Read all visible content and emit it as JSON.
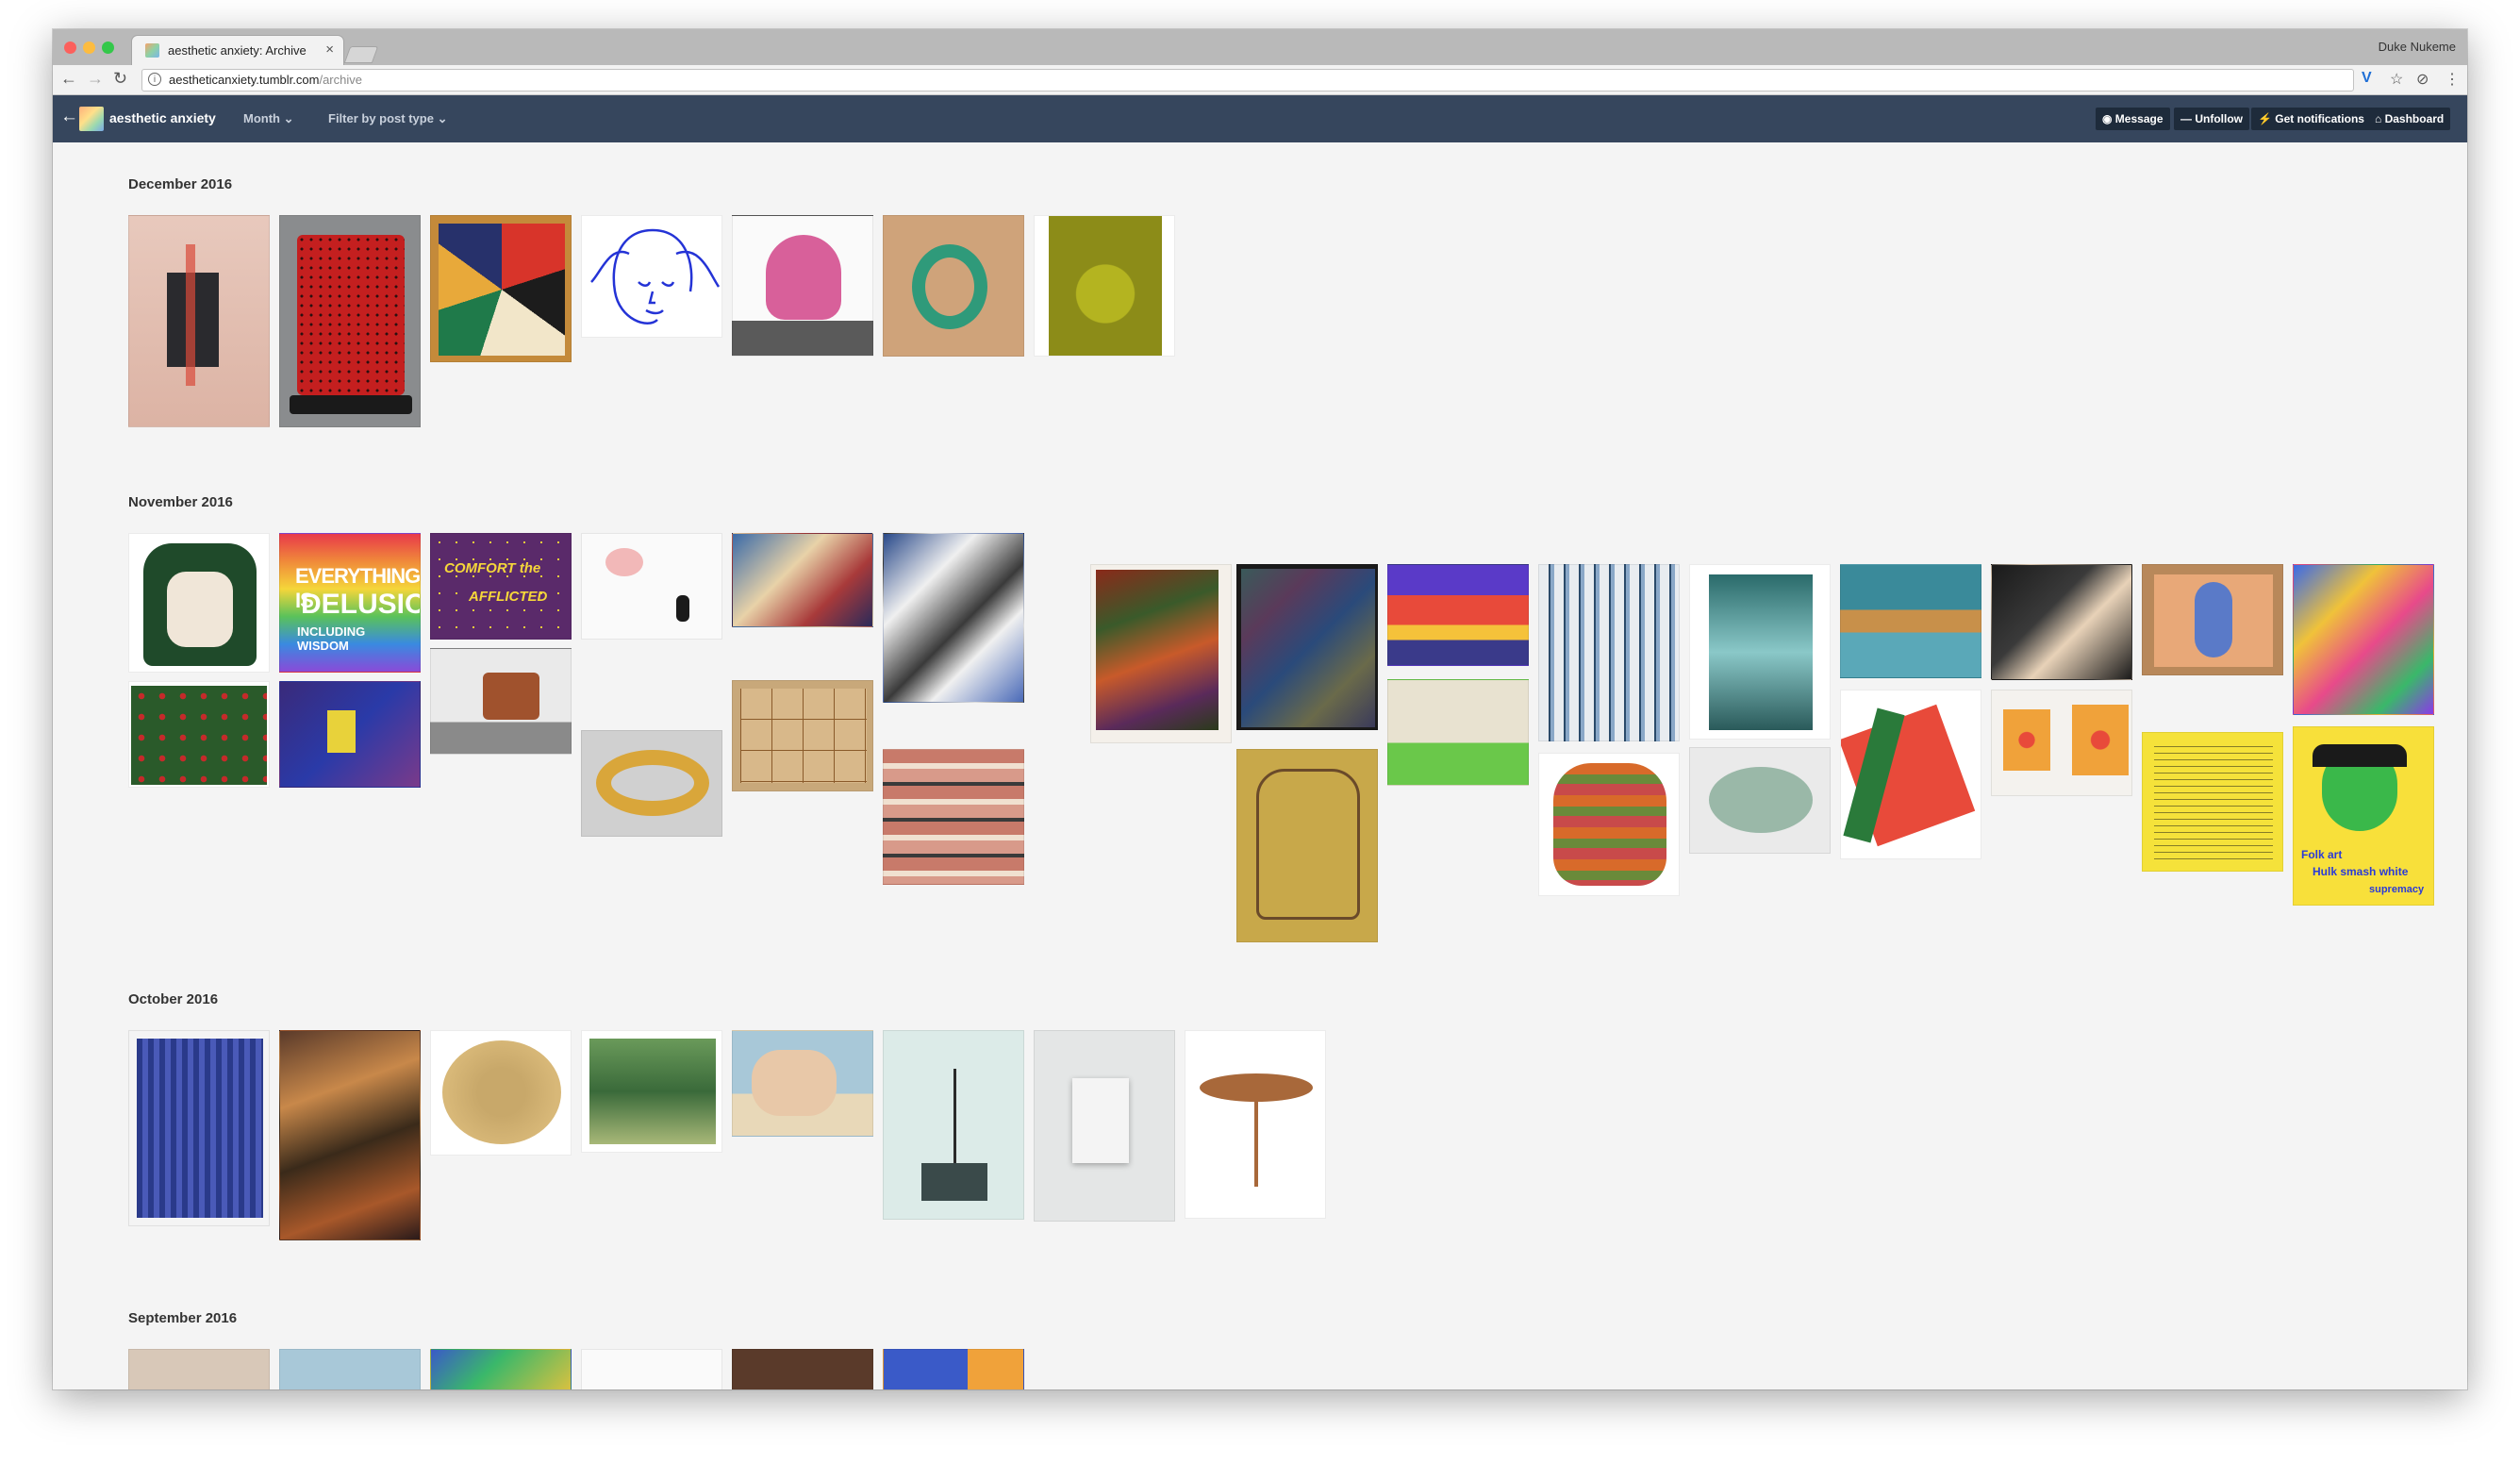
{
  "browser": {
    "tab_title": "aesthetic anxiety: Archive",
    "tab_close": "×",
    "profile_name": "Duke Nukeme",
    "url_host": "aestheticanxiety.tumblr.com",
    "url_path": "/archive",
    "icons": {
      "back": "←",
      "forward": "→",
      "reload": "↻",
      "info": "i",
      "ext1": "V",
      "star": "☆",
      "ext2": "⊘",
      "menu": "⋮"
    }
  },
  "tumblr_bar": {
    "back_icon": "←",
    "blog_name": "aesthetic anxiety",
    "filter_month": "Month ⌄",
    "filter_type": "Filter by post type ⌄",
    "buttons": {
      "message": "◉ Message",
      "unfollow": "— Unfollow",
      "notifications": "⚡ Get notifications",
      "dashboard": "⌂ Dashboard"
    },
    "background_color": "#36465d"
  },
  "archive": {
    "sections": [
      {
        "title": "December 2016"
      },
      {
        "title": "November 2016"
      },
      {
        "title": "October 2016"
      },
      {
        "title": "September 2016"
      }
    ],
    "thumbnail_texts": {
      "delusion_line1": "EVERYTHING IS",
      "delusion_line2": "DELUSION",
      "delusion_line3": "INCLUDING WISDOM",
      "comfort_line1": "COMFORT the",
      "comfort_line2": "AFFLICTED",
      "hulk_caption_1": "Folk art",
      "hulk_caption_2": "Hulk smash white",
      "hulk_caption_3": "supremacy"
    }
  }
}
